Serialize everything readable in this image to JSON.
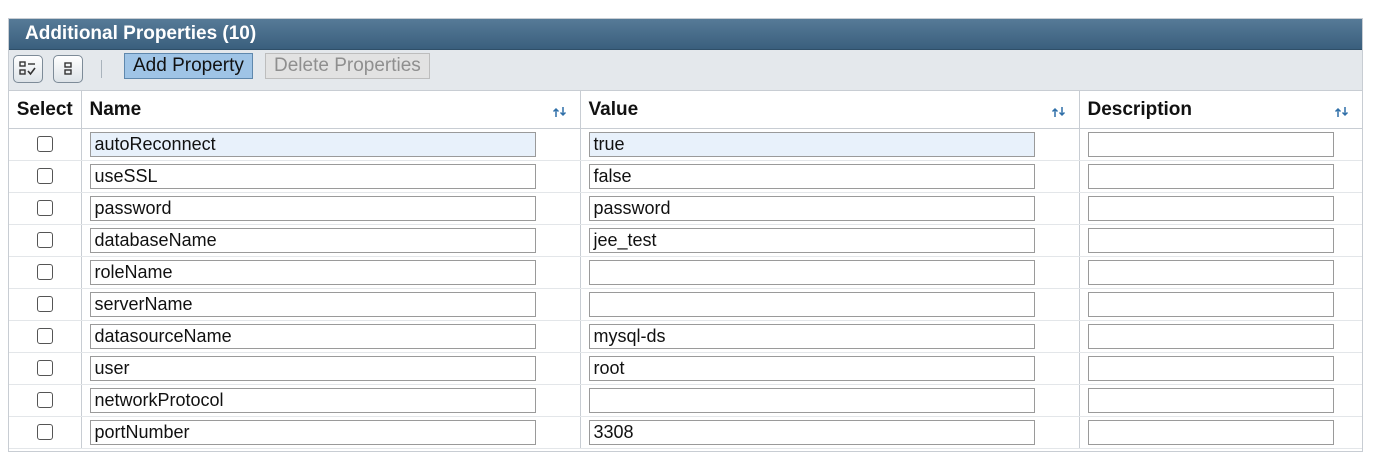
{
  "title": "Additional Properties (10)",
  "toolbar": {
    "select_all_icon": "select-all-icon",
    "deselect_all_icon": "deselect-all-icon",
    "add_label": "Add Property",
    "delete_label": "Delete Properties"
  },
  "columns": {
    "select": "Select",
    "name": "Name",
    "value": "Value",
    "description": "Description"
  },
  "rows": [
    {
      "name": "autoReconnect",
      "value": "true",
      "description": ""
    },
    {
      "name": "useSSL",
      "value": "false",
      "description": ""
    },
    {
      "name": "password",
      "value": "password",
      "description": ""
    },
    {
      "name": "databaseName",
      "value": "jee_test",
      "description": ""
    },
    {
      "name": "roleName",
      "value": "",
      "description": ""
    },
    {
      "name": "serverName",
      "value": "",
      "description": ""
    },
    {
      "name": "datasourceName",
      "value": "mysql-ds",
      "description": ""
    },
    {
      "name": "user",
      "value": "root",
      "description": ""
    },
    {
      "name": "networkProtocol",
      "value": "",
      "description": ""
    },
    {
      "name": "portNumber",
      "value": "3308",
      "description": ""
    }
  ],
  "colors": {
    "title_bar": "#3a5f7d",
    "add_button": "#9fc4e6",
    "sort_icon": "#2f6fa8"
  }
}
